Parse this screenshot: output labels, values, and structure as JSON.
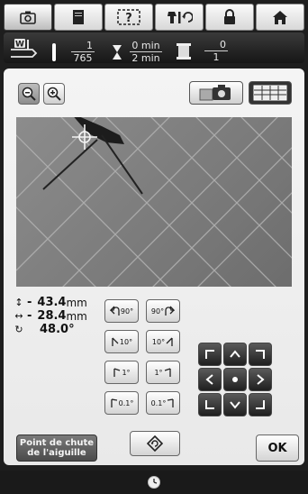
{
  "tabs": [
    {
      "icon": "camera-icon",
      "active": true
    },
    {
      "icon": "page-icon",
      "active": false
    },
    {
      "icon": "help-icon",
      "label": "?",
      "active": false
    },
    {
      "icon": "needle-swap-icon",
      "active": false
    },
    {
      "icon": "lock-icon",
      "active": false
    },
    {
      "icon": "home-icon",
      "active": false
    }
  ],
  "status": {
    "stitch_current": "1",
    "stitch_total": "765",
    "time_current": "0 min",
    "time_total": "2 min",
    "thread_current": "0",
    "thread_total": "1"
  },
  "readout": {
    "y_sign": "-",
    "y_value": "43.4",
    "x_sign": "-",
    "x_value": "28.4",
    "unit": "mm",
    "angle": "48.0°"
  },
  "rotate_buttons": [
    {
      "label": "90°",
      "direction": "left"
    },
    {
      "label": "90°",
      "direction": "right"
    },
    {
      "label": "10°",
      "direction": "left"
    },
    {
      "label": "10°",
      "direction": "right"
    },
    {
      "label": "1°",
      "direction": "left"
    },
    {
      "label": "1°",
      "direction": "right"
    },
    {
      "label": "0.1°",
      "direction": "left"
    },
    {
      "label": "0.1°",
      "direction": "right"
    }
  ],
  "drop_point_label_1": "Point de chute",
  "drop_point_label_2": "de l'aiguille",
  "ok_label": "OK",
  "colors": {
    "accent_dark": "#2a2a2a",
    "panel": "#efefef",
    "camera_bg": "#7f7f7f"
  }
}
